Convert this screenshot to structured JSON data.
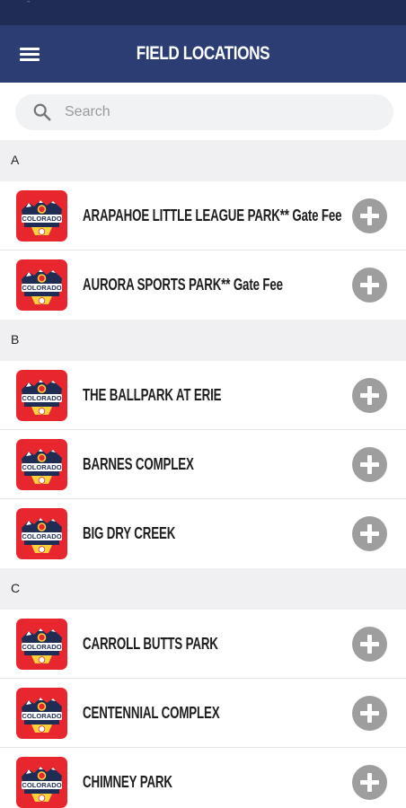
{
  "status_bar": {
    "indicator": "ᵔ"
  },
  "app_bar": {
    "title": "FIELD LOCATIONS",
    "menu_icon": "hamburger-menu-icon"
  },
  "search": {
    "placeholder": "Search",
    "value": "",
    "icon": "search-icon"
  },
  "sections": [
    {
      "letter": "A",
      "items": [
        {
          "name": "ARAPAHOE LITTLE LEAGUE PARK** Gate Fee"
        },
        {
          "name": "AURORA SPORTS PARK** Gate Fee"
        }
      ]
    },
    {
      "letter": "B",
      "items": [
        {
          "name": "THE BALLPARK AT ERIE"
        },
        {
          "name": "BARNES COMPLEX"
        },
        {
          "name": "BIG DRY CREEK"
        }
      ]
    },
    {
      "letter": "C",
      "items": [
        {
          "name": "CARROLL BUTTS PARK"
        },
        {
          "name": "CENTENNIAL COMPLEX"
        },
        {
          "name": "CHIMNEY PARK"
        }
      ]
    }
  ],
  "logo_text": "COLORADO",
  "colors": {
    "app_bar": "#2b3d73",
    "status_bar": "#1f2d54",
    "logo_red": "#e8262d",
    "add_button": "#9e9e9e"
  }
}
